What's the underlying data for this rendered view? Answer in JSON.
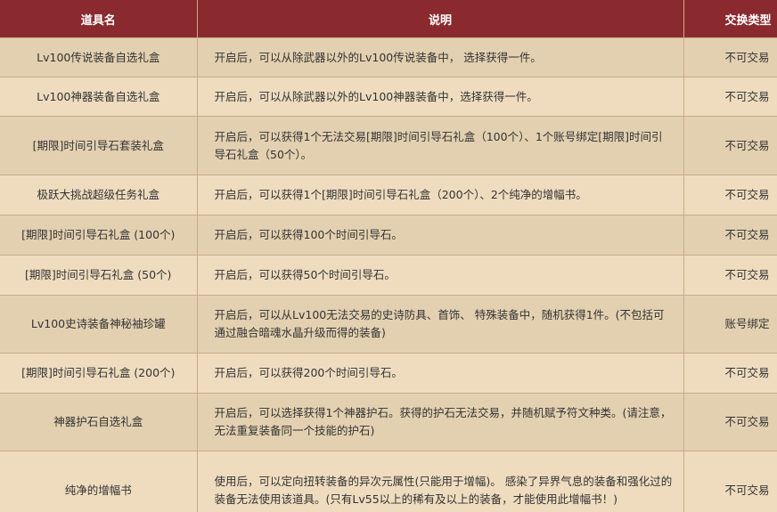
{
  "headers": {
    "name": "道具名",
    "description": "说明",
    "trade_type": "交换类型"
  },
  "rows": [
    {
      "name": "Lv100传说装备自选礼盒",
      "description": "开启后，可以从除武器以外的Lv100传说装备中， 选择获得一件。",
      "trade": "不可交易"
    },
    {
      "name": "Lv100神器装备自选礼盒",
      "description": "开启后，可以从除武器以外的Lv100神器装备中，选择获得一件。",
      "trade": "不可交易"
    },
    {
      "name": "[期限]时间引导石套装礼盒",
      "description": "开启后，可以获得1个无法交易[期限]时间引导石礼盒（100个）、1个账号绑定[期限]时间引导石礼盒（50个）。",
      "trade": "不可交易"
    },
    {
      "name": "极跃大挑战超级任务礼盒",
      "description": "开启后，可以获得1个[期限]时间引导石礼盒（200个）、2个纯净的增幅书。",
      "trade": "不可交易"
    },
    {
      "name": "[期限]时间引导石礼盒 (100个)",
      "description": "开启后，可以获得100个时间引导石。",
      "trade": "不可交易"
    },
    {
      "name": "[期限]时间引导石礼盒 (50个)",
      "description": "开启后，可以获得50个时间引导石。",
      "trade": "不可交易"
    },
    {
      "name": "Lv100史诗装备神秘袖珍罐",
      "description": "开启后，可以从Lv100无法交易的史诗防具、首饰、 特殊装备中，随机获得1件。(不包括可通过融合暗魂水晶升级而得的装备)",
      "trade": "账号绑定"
    },
    {
      "name": "[期限]时间引导石礼盒 (200个)",
      "description": "开启后，可以获得200个时间引导石。",
      "trade": "不可交易"
    },
    {
      "name": "神器护石自选礼盒",
      "description": "开启后，可以选择获得1个神器护石。获得的护石无法交易，并随机赋予符文种类。(请注意，无法重复装备同一个技能的护石)",
      "trade": "不可交易"
    },
    {
      "name": "纯净的增幅书",
      "description": "使用后，可以定向扭转装备的异次元属性(只能用于增幅)。 感染了异界气息的装备和强化过的装备无法使用该道具。(只有Lv55以上的稀有及以上的装备，才能使用此增幅书！)",
      "trade": "不可交易"
    }
  ],
  "colors": {
    "header_bg": "#8a2a2e",
    "row_odd": "#e3d0b0",
    "row_even": "#efdcbf",
    "border": "#c9a98b"
  }
}
